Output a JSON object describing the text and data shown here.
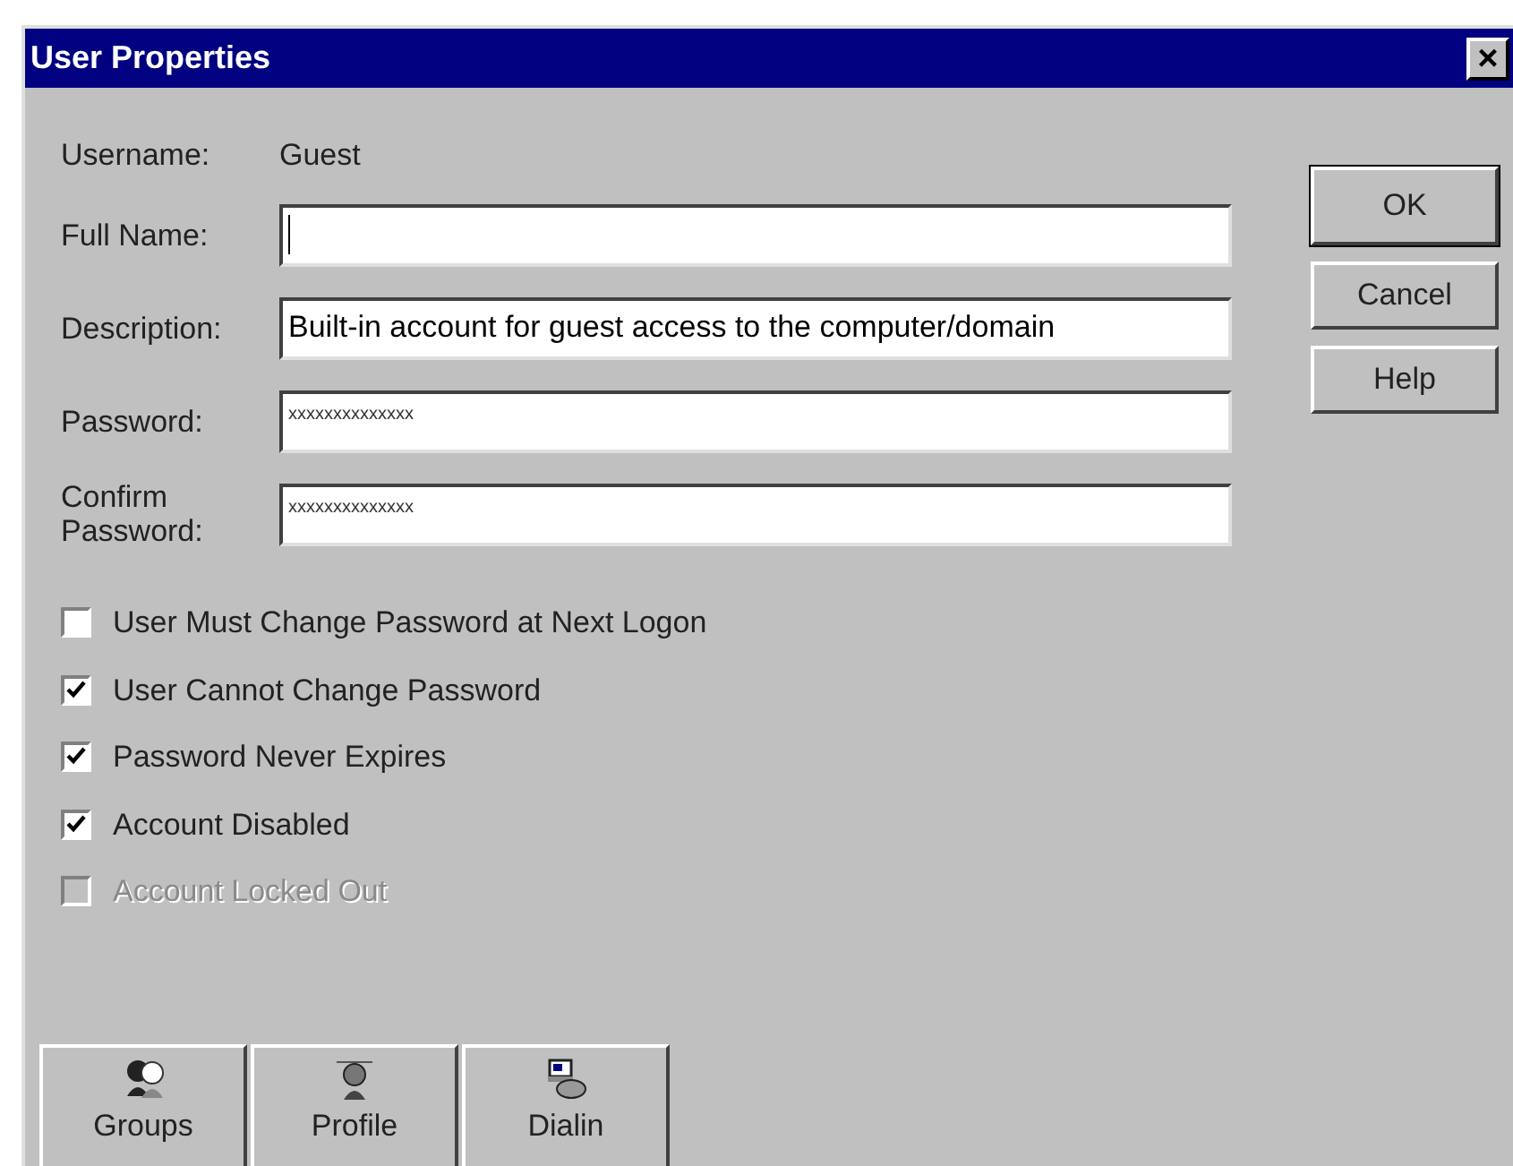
{
  "window": {
    "title": "User Properties",
    "close_glyph": "×"
  },
  "username": {
    "label": "Username:",
    "value": "Guest"
  },
  "fields": [
    {
      "label": "Full Name:",
      "focused": true
    },
    {
      "label": "Description:",
      "value": "Built-in account for guest access to the computer/domain",
      "focused": false
    },
    {
      "label": "Password:",
      "value": "xxxxxxxxxxxxxx",
      "focused": false
    },
    {
      "label": "Confirm Password:",
      "value": "xxxxxxxxxxxxxx",
      "focused": false
    }
  ],
  "checkboxes": [
    {
      "label": "User Must Change Password at Next Logon",
      "checked": false,
      "disabled": false
    },
    {
      "label": "User Cannot Change Password",
      "checked": true,
      "disabled": false
    },
    {
      "label": "Password Never Expires",
      "checked": true,
      "disabled": false
    },
    {
      "label": "Account Disabled",
      "checked": true,
      "disabled": false
    },
    {
      "label": "Account Locked Out",
      "checked": false,
      "disabled": true
    }
  ],
  "buttons": [
    {
      "label": "OK",
      "default": true
    },
    {
      "label": "Cancel",
      "default": false
    },
    {
      "label": "Help",
      "default": false
    }
  ],
  "bottom_buttons": [
    {
      "label": "Groups",
      "kind": "groups"
    },
    {
      "label": "Profile",
      "kind": "profile"
    },
    {
      "label": "Dialin",
      "kind": "dialin"
    }
  ]
}
